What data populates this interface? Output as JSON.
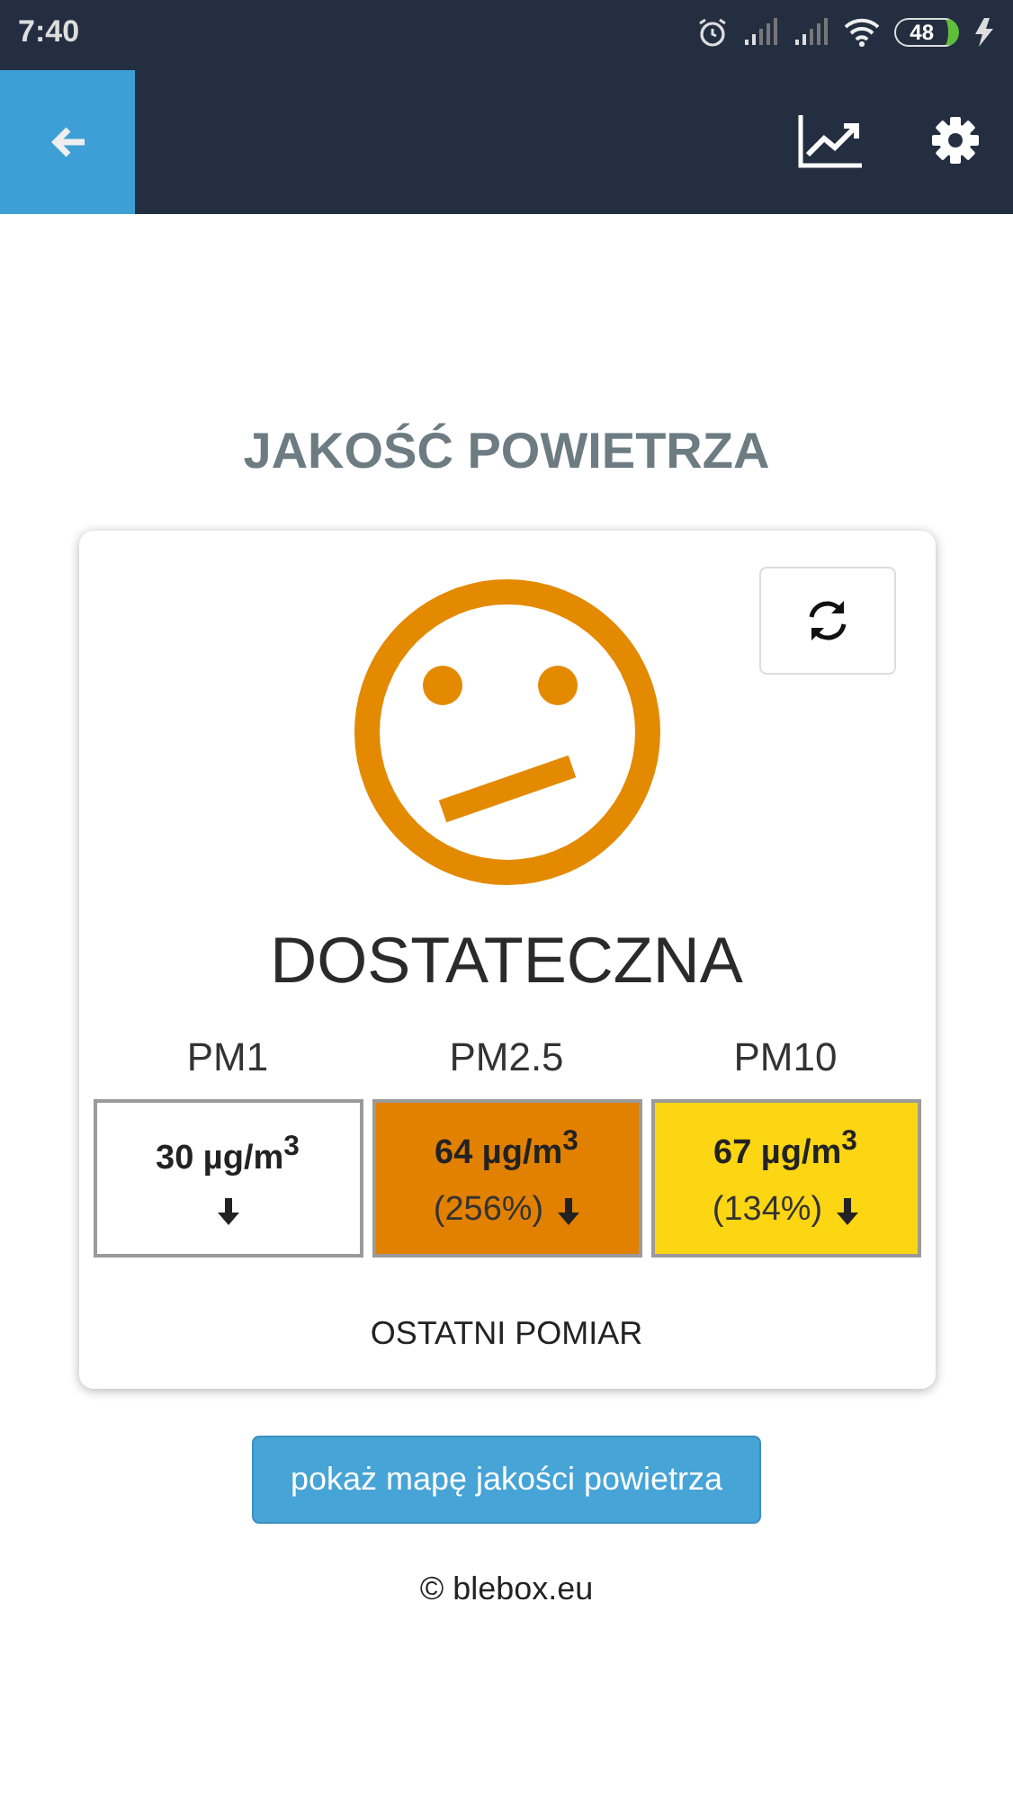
{
  "status_bar": {
    "time": "7:40",
    "battery": "48"
  },
  "title": "JAKOŚĆ POWIETRZA",
  "quality": {
    "label": "DOSTATECZNA"
  },
  "measurements": [
    {
      "name": "PM1",
      "value": "30 µg/m$^{3}$",
      "color": "#ffffff"
    },
    {
      "name": "PM2.5",
      "value": "64 µg/m$^{3}$",
      "percent": "(256%)",
      "color": "#e28000"
    },
    {
      "name": "PM10",
      "value": "67 µg/m$^{3}$",
      "percent": "(134%)",
      "color": "#fcd612"
    }
  ],
  "last_measurement": "OSTATNI POMIAR",
  "map_button": "pokaż mapę jakości powietrza",
  "footer": "© blebox.eu"
}
